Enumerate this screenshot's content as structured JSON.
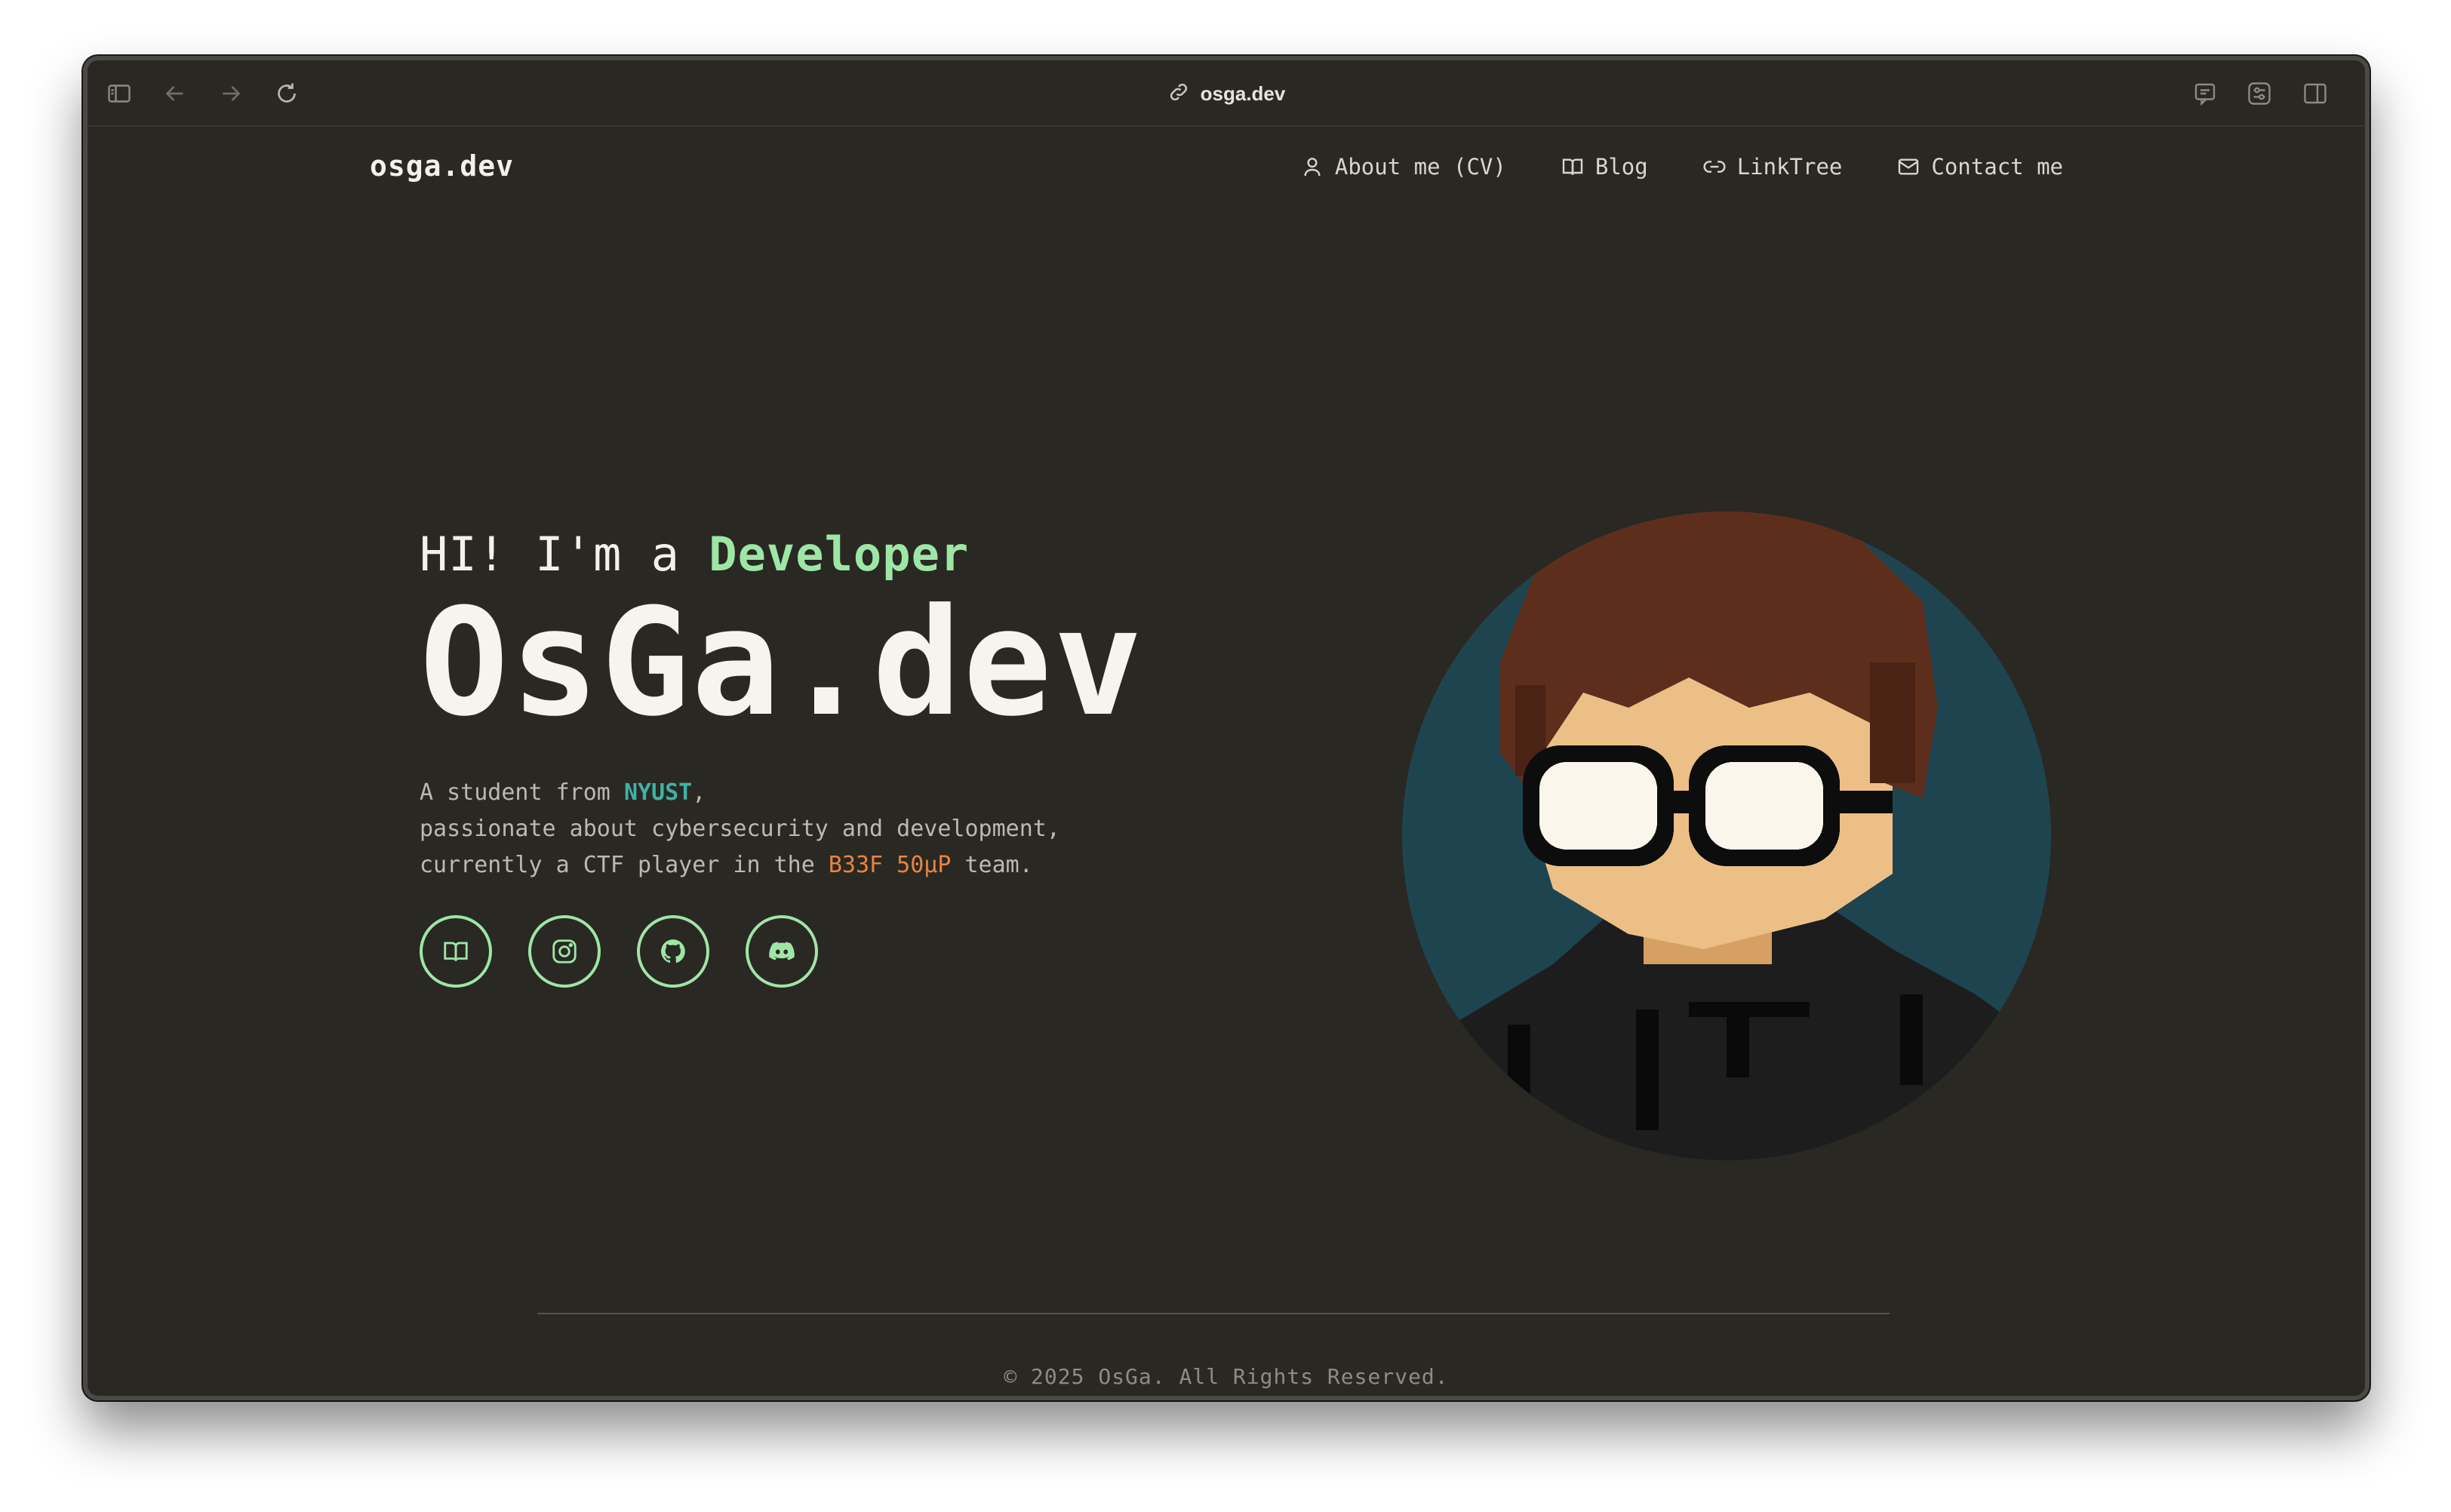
{
  "browser": {
    "url": "osga.dev",
    "icons": [
      "sidebar-icon",
      "back-arrow-icon",
      "forward-arrow-icon",
      "reload-icon",
      "link-icon",
      "chat-icon",
      "settings-sliders-icon",
      "split-view-icon"
    ]
  },
  "site": {
    "logo": "osga.dev",
    "nav": [
      {
        "label": "About me (CV)",
        "icon": "person-icon"
      },
      {
        "label": "Blog",
        "icon": "book-icon"
      },
      {
        "label": "LinkTree",
        "icon": "link-icon"
      },
      {
        "label": "Contact me",
        "icon": "mail-icon"
      }
    ]
  },
  "hero": {
    "greeting_prefix": "HI! I'm a ",
    "greeting_accent": "Developer",
    "title": "OsGa.dev",
    "line1_prefix": "A student from ",
    "line1_highlight": "NYUST",
    "line1_suffix": ",",
    "line2": "passionate about cybersecurity and development,",
    "line3_prefix": "currently a CTF player in the ",
    "line3_highlight": "B33F 50µP",
    "line3_suffix": " team.",
    "socials": [
      "book-icon",
      "instagram-icon",
      "github-icon",
      "discord-icon"
    ]
  },
  "colors": {
    "background": "#2a2823",
    "accent_green": "#9ee6a6",
    "accent_teal": "#3fb2a6",
    "accent_orange": "#e8853f",
    "avatar_bg": "#1e4450"
  },
  "footer": {
    "copyright": "© 2025 OsGa. All Rights Reserved."
  }
}
